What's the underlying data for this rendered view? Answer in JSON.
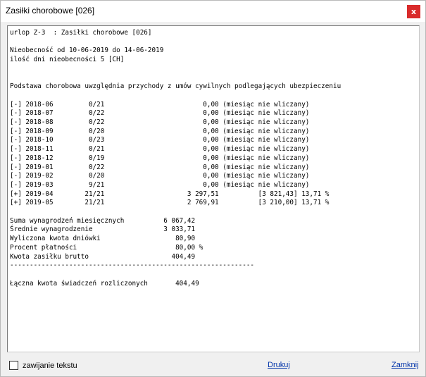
{
  "window": {
    "title": "Zasiłki chorobowe [026]",
    "close_glyph": "x"
  },
  "report": {
    "lines": [
      "urlop Z-3  : Zasiłki chorobowe [026]",
      "",
      "Nieobecność od 10-06-2019 do 14-06-2019",
      "ilość dni nieobecności 5 [CH]",
      "",
      "",
      "Podstawa chorobowa uwzględnia przychody z umów cywilnych podlegających ubezpieczeniu",
      "",
      "[-] 2018-06         0/21                         0,00 (miesiąc nie wliczany)",
      "[-] 2018-07         0/22                         0,00 (miesiąc nie wliczany)",
      "[-] 2018-08         0/22                         0,00 (miesiąc nie wliczany)",
      "[-] 2018-09         0/20                         0,00 (miesiąc nie wliczany)",
      "[-] 2018-10         0/23                         0,00 (miesiąc nie wliczany)",
      "[-] 2018-11         0/21                         0,00 (miesiąc nie wliczany)",
      "[-] 2018-12         0/19                         0,00 (miesiąc nie wliczany)",
      "[-] 2019-01         0/22                         0,00 (miesiąc nie wliczany)",
      "[-] 2019-02         0/20                         0,00 (miesiąc nie wliczany)",
      "[-] 2019-03         9/21                         0,00 (miesiąc nie wliczany)",
      "[+] 2019-04        21/21                     3 297,51          [3 821,43] 13,71 %",
      "[+] 2019-05        21/21                     2 769,91          [3 210,00] 13,71 %",
      "",
      "Suma wynagrodzeń miesięcznych          6 067,42",
      "Średnie wynagrodzenie                  3 033,71",
      "Wyliczona kwota dniówki                   80,90",
      "Procent płatności                         80,00 %",
      "Kwota zasiłku brutto                     404,49",
      "--------------------------------------------------------------",
      "",
      "Łączna kwota świadczeń rozliczonych       404,49"
    ]
  },
  "footer": {
    "wrap_label": "zawijanie tekstu",
    "wrap_checked": false,
    "print_label": "Drukuj",
    "close_label": "Zamknij"
  },
  "colors": {
    "close_button": "#d92b2b",
    "link": "#0033aa"
  }
}
